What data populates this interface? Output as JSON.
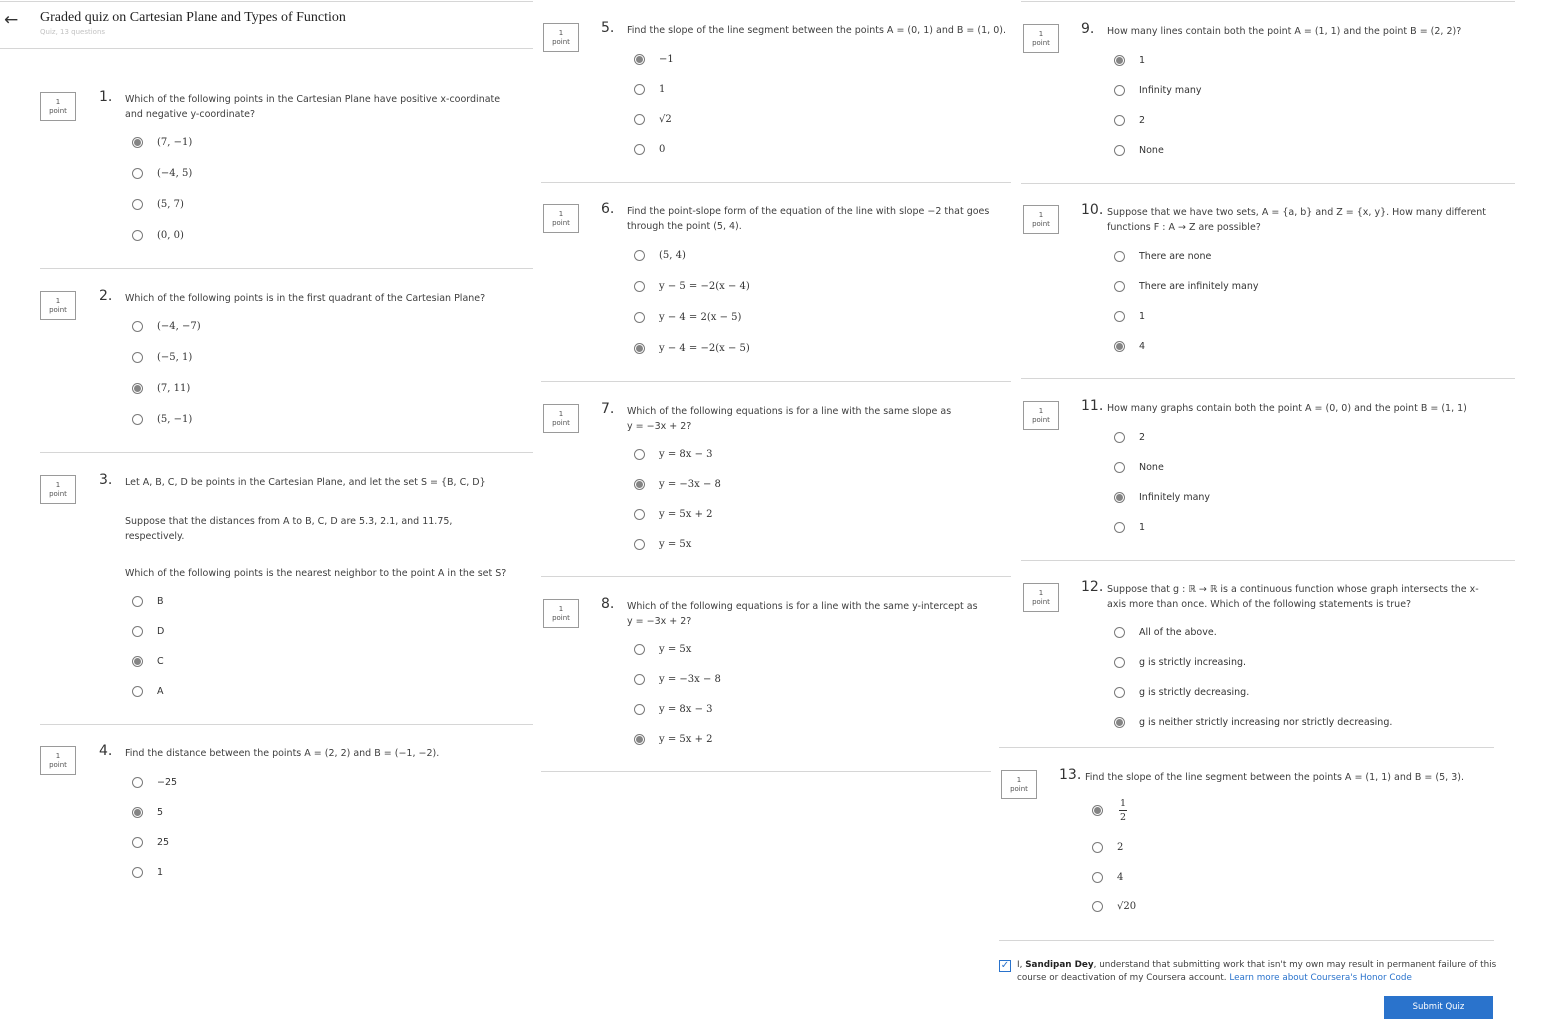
{
  "header": {
    "back_icon": "arrow-left-icon",
    "title": "Graded quiz on Cartesian Plane and Types of Function",
    "subtitle": "Quiz, 13 questions"
  },
  "points_label": {
    "num": "1",
    "word": "point"
  },
  "colors": {
    "accent": "#2a73cc",
    "selected_radio": "#848484",
    "divider": "#d6d6d6"
  },
  "questions": [
    {
      "number": "1.",
      "text": "Which of the following points in the Cartesian Plane have positive x-coordinate and negative y-coordinate?",
      "options": [
        "(7, −1)",
        "(−4, 5)",
        "(5, 7)",
        "(0, 0)"
      ],
      "selected": 0
    },
    {
      "number": "2.",
      "text": "Which of the following points is in the first quadrant of the Cartesian Plane?",
      "options": [
        "(−4, −7)",
        "(−5, 1)",
        "(7, 11)",
        "(5, −1)"
      ],
      "selected": 2
    },
    {
      "number": "3.",
      "text": "Let A, B, C, D be points in the Cartesian Plane, and let the set S = {B, C, D}",
      "text2": "Suppose that the distances from A to B, C, D are 5.3, 2.1, and 11.75, respectively.",
      "text3": "Which of the following points is the nearest neighbor to the point A in the set S?",
      "options": [
        "B",
        "D",
        "C",
        "A"
      ],
      "selected": 2
    },
    {
      "number": "4.",
      "text": "Find the distance between the points A = (2, 2) and B = (−1, −2).",
      "options": [
        "−25",
        "5",
        "25",
        "1"
      ],
      "selected": 1
    },
    {
      "number": "5.",
      "text": "Find the slope of the line segment between the points A = (0, 1) and B = (1, 0).",
      "options": [
        "−1",
        "1",
        "√2",
        "0"
      ],
      "selected": 0
    },
    {
      "number": "6.",
      "text": "Find the point-slope form of the equation of the line with slope −2 that goes through the point (5, 4).",
      "options": [
        "(5, 4)",
        "y − 5 = −2(x − 4)",
        "y − 4 = 2(x − 5)",
        "y − 4 = −2(x − 5)"
      ],
      "selected": 3
    },
    {
      "number": "7.",
      "text": "Which of the following equations is for a line with the same slope as y = −3x + 2?",
      "options": [
        "y = 8x − 3",
        "y = −3x − 8",
        "y = 5x + 2",
        "y = 5x"
      ],
      "selected": 1
    },
    {
      "number": "8.",
      "text": "Which of the following equations is for a line with the same y-intercept as y = −3x + 2?",
      "options": [
        "y = 5x",
        "y = −3x − 8",
        "y = 8x − 3",
        "y = 5x + 2"
      ],
      "selected": 3
    },
    {
      "number": "9.",
      "text": "How many lines contain both the point A = (1, 1) and the point B = (2, 2)?",
      "options": [
        "1",
        "Infinity many",
        "2",
        "None"
      ],
      "selected": 0
    },
    {
      "number": "10.",
      "text": "Suppose that we have two sets, A = {a, b} and Z = {x, y}. How many different functions F : A → Z are possible?",
      "options": [
        "There are none",
        "There are infinitely many",
        "1",
        "4"
      ],
      "selected": 3
    },
    {
      "number": "11.",
      "text": "How many graphs contain both the point A = (0, 0) and the point B = (1, 1)",
      "options": [
        "2",
        "None",
        "Infinitely many",
        "1"
      ],
      "selected": 2
    },
    {
      "number": "12.",
      "text": "Suppose that g : ℝ → ℝ is a continuous function whose graph intersects the x-axis more than once. Which of the following statements is true?",
      "options": [
        "All of the above.",
        "g is strictly increasing.",
        "g is strictly decreasing.",
        "g is neither strictly increasing nor strictly decreasing."
      ],
      "selected": 3
    },
    {
      "number": "13.",
      "text": "Find the slope of the line segment between the points A = (1, 1) and B = (5, 3).",
      "options": [
        "1/2",
        "2",
        "4",
        "√20"
      ],
      "selected": 0
    }
  ],
  "honor": {
    "checkbox_icon": "checkbox-checked-icon",
    "prefix": "I, ",
    "name": "Sandipan Dey",
    "text": ", understand that submitting work that isn't my own may result in permanent failure of this course or deactivation of my Coursera account.",
    "link": "Learn more about Coursera's Honor Code"
  },
  "submit_label": "Submit Quiz"
}
